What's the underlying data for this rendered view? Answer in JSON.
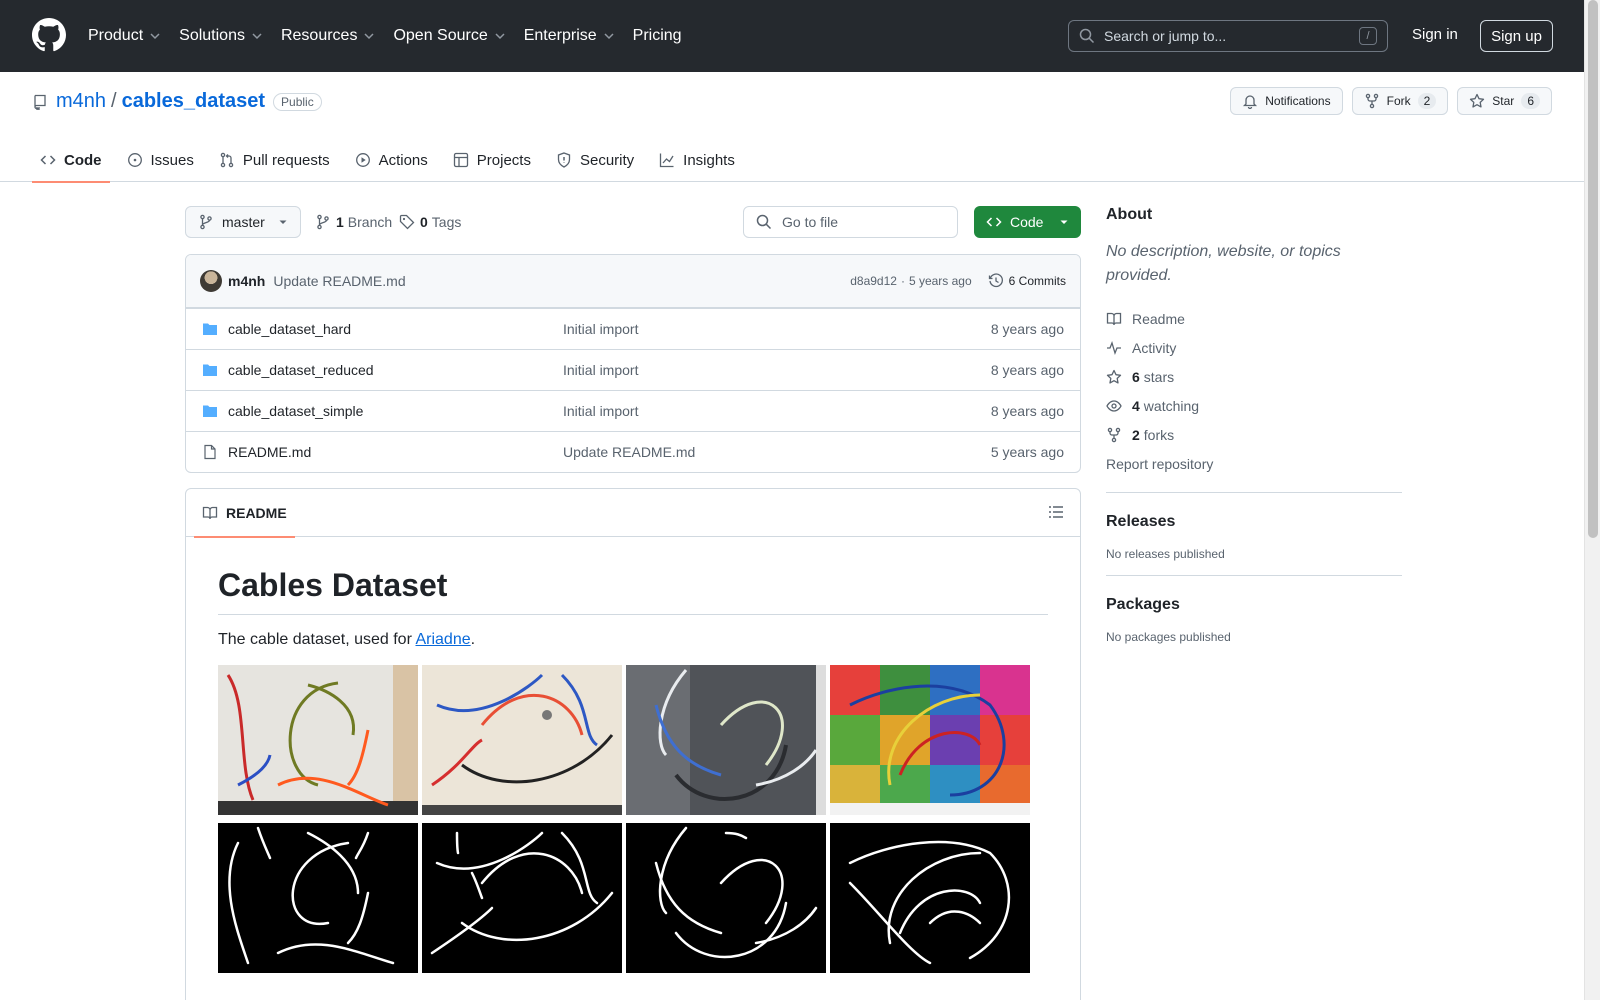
{
  "header": {
    "nav": [
      {
        "label": "Product",
        "dropdown": true
      },
      {
        "label": "Solutions",
        "dropdown": true
      },
      {
        "label": "Resources",
        "dropdown": true
      },
      {
        "label": "Open Source",
        "dropdown": true
      },
      {
        "label": "Enterprise",
        "dropdown": true
      },
      {
        "label": "Pricing",
        "dropdown": false
      }
    ],
    "search_placeholder": "Search or jump to...",
    "search_shortcut": "/",
    "signin": "Sign in",
    "signup": "Sign up"
  },
  "repo": {
    "owner": "m4nh",
    "separator": "/",
    "name": "cables_dataset",
    "visibility": "Public",
    "notifications_label": "Notifications",
    "fork_label": "Fork",
    "fork_count": "2",
    "star_label": "Star",
    "star_count": "6"
  },
  "tabs": [
    {
      "label": "Code",
      "active": true,
      "icon": "code-icon"
    },
    {
      "label": "Issues",
      "icon": "issue-icon"
    },
    {
      "label": "Pull requests",
      "icon": "pull-request-icon"
    },
    {
      "label": "Actions",
      "icon": "play-icon"
    },
    {
      "label": "Projects",
      "icon": "table-icon"
    },
    {
      "label": "Security",
      "icon": "shield-icon"
    },
    {
      "label": "Insights",
      "icon": "graph-icon"
    }
  ],
  "toolbar": {
    "branch": "master",
    "branch_count": "1",
    "branch_label": "Branch",
    "tag_count": "0",
    "tag_label": "Tags",
    "goto_placeholder": "Go to file",
    "code_button": "Code"
  },
  "latest_commit": {
    "author": "m4nh",
    "message": "Update README.md",
    "hash": "d8a9d12",
    "dot": "·",
    "age": "5 years ago",
    "commits_label": "6 Commits"
  },
  "files": [
    {
      "name": "cable_dataset_hard",
      "type": "folder",
      "message": "Initial import",
      "age": "8 years ago"
    },
    {
      "name": "cable_dataset_reduced",
      "type": "folder",
      "message": "Initial import",
      "age": "8 years ago"
    },
    {
      "name": "cable_dataset_simple",
      "type": "folder",
      "message": "Initial import",
      "age": "8 years ago"
    },
    {
      "name": "README.md",
      "type": "file",
      "message": "Update README.md",
      "age": "5 years ago"
    }
  ],
  "readme": {
    "tab_label": "README",
    "title": "Cables Dataset",
    "text_before": "The cable dataset, used for ",
    "link": "Ariadne",
    "text_after": "."
  },
  "sidebar": {
    "about_title": "About",
    "description": "No description, website, or topics provided.",
    "links": [
      {
        "icon": "book-icon",
        "count": "",
        "label": "Readme"
      },
      {
        "icon": "pulse-icon",
        "count": "",
        "label": "Activity"
      },
      {
        "icon": "star-icon",
        "count": "6",
        "label": "stars"
      },
      {
        "icon": "eye-icon",
        "count": "4",
        "label": "watching"
      },
      {
        "icon": "fork-icon",
        "count": "2",
        "label": "forks"
      }
    ],
    "report": "Report repository",
    "releases_title": "Releases",
    "releases_text": "No releases published",
    "packages_title": "Packages",
    "packages_text": "No packages published"
  },
  "colors": {
    "header_bg": "#25292e",
    "link": "#0969da",
    "green": "#1f883d",
    "tab_underline": "#fd8c73",
    "folder": "#54aeff"
  }
}
